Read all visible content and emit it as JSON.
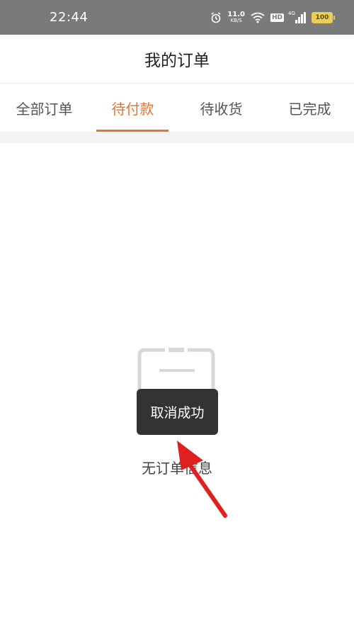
{
  "status_bar": {
    "time": "22:44",
    "net_speed": "11.0",
    "net_unit": "KB/S",
    "hd": "HD",
    "signal": "4G",
    "battery": "100"
  },
  "header": {
    "title": "我的订单"
  },
  "tabs": [
    {
      "label": "全部订单",
      "active": false
    },
    {
      "label": "待付款",
      "active": true
    },
    {
      "label": "待收货",
      "active": false
    },
    {
      "label": "已完成",
      "active": false
    }
  ],
  "empty_state": {
    "text": "无订单信息"
  },
  "toast": {
    "text": "取消成功"
  },
  "colors": {
    "accent": "#e8732d",
    "status_bar_bg": "#7a7a7a",
    "toast_bg": "#333333",
    "arrow": "#e0201e"
  }
}
